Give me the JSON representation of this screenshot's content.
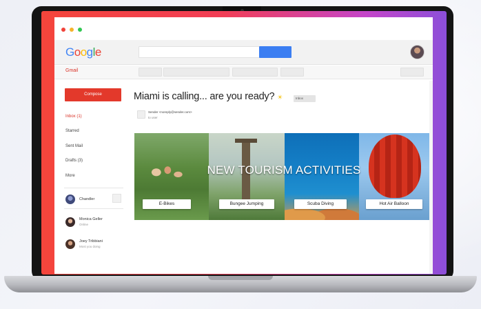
{
  "window": {
    "controls": [
      "close",
      "minimize",
      "maximize"
    ]
  },
  "header": {
    "logo_letters": [
      "G",
      "o",
      "o",
      "g",
      "l",
      "e"
    ],
    "search_placeholder": "",
    "search_button_color": "#3b7ef2"
  },
  "subheader": {
    "app_label": "Gmail"
  },
  "sidebar": {
    "compose_label": "Compose",
    "items": [
      {
        "label": "Inbox (1)",
        "active": true
      },
      {
        "label": "Starred",
        "active": false
      },
      {
        "label": "Sent Mail",
        "active": false
      },
      {
        "label": "Drafts (3)",
        "active": false
      },
      {
        "label": "More",
        "active": false
      }
    ],
    "contacts": [
      {
        "name": "Chandler",
        "status": ""
      },
      {
        "name": "Monica Geller",
        "status": "Online"
      },
      {
        "name": "Joey Tribbiani",
        "status": "Most you doing"
      }
    ]
  },
  "message": {
    "subject": "Miami is calling... are you ready?",
    "subject_emoji": "☀",
    "label": "Inbox",
    "sender": "Sender <noreply@sender.com>",
    "to": "to user"
  },
  "banner": {
    "headline": "NEW TOURISM ACTIVITIES",
    "activities": [
      "E-Bikes",
      "Bungee Jumping",
      "Scuba Diving",
      "Hot Air Balloon"
    ]
  },
  "colors": {
    "compose": "#e3392b",
    "gradient_start": "#f4453b",
    "gradient_end": "#8c4fd9",
    "active_nav": "#d93025"
  },
  "icons": [
    "close-dot-icon",
    "minimize-dot-icon",
    "maximize-dot-icon",
    "user-avatar-icon",
    "sender-icon"
  ]
}
